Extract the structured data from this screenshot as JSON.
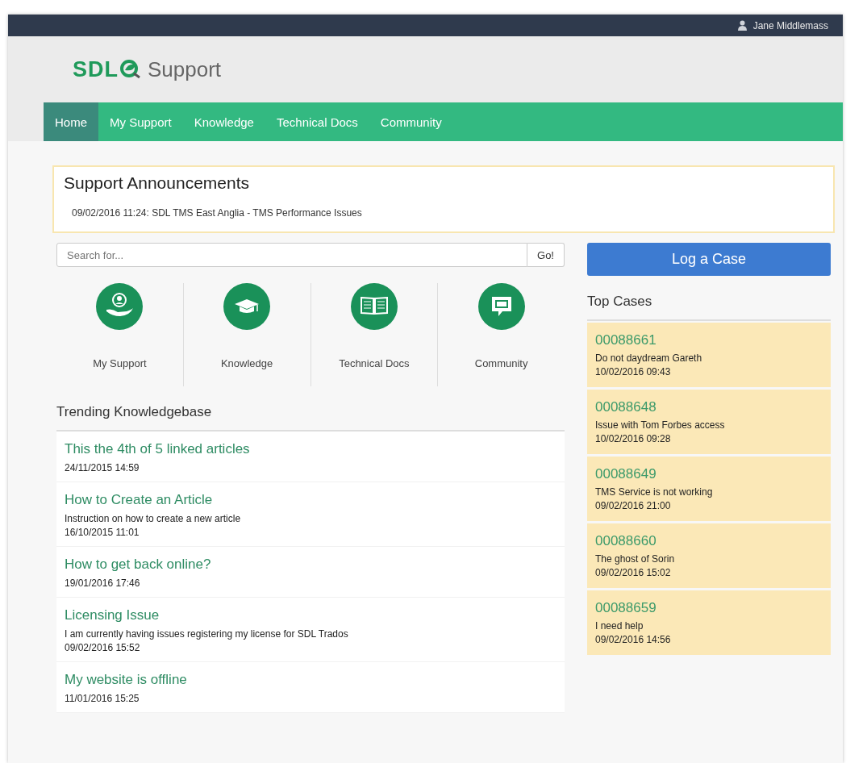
{
  "user": {
    "name": "Jane Middlemass"
  },
  "logo": {
    "brand": "SDL",
    "product": "Support"
  },
  "nav": [
    {
      "label": "Home",
      "selected": true
    },
    {
      "label": "My Support",
      "selected": false
    },
    {
      "label": "Knowledge",
      "selected": false
    },
    {
      "label": "Technical Docs",
      "selected": false
    },
    {
      "label": "Community",
      "selected": false
    }
  ],
  "announcements": {
    "title": "Support Announcements",
    "items": [
      "09/02/2016 11:24: SDL TMS East Anglia - TMS Performance Issues"
    ]
  },
  "search": {
    "placeholder": "Search for...",
    "button": "Go!"
  },
  "tiles": [
    {
      "label": "My Support",
      "kind": "support"
    },
    {
      "label": "Knowledge",
      "kind": "knowledge"
    },
    {
      "label": "Technical Docs",
      "kind": "docs"
    },
    {
      "label": "Community",
      "kind": "community"
    }
  ],
  "trending": {
    "title": "Trending Knowledgebase",
    "articles": [
      {
        "title": "This the 4th of 5 linked articles",
        "date": "24/11/2015 14:59"
      },
      {
        "title": "How to Create an Article",
        "summary": "Instruction on how to create a new article",
        "date": "16/10/2015 11:01"
      },
      {
        "title": "How to get back online?",
        "date": "19/01/2016 17:46"
      },
      {
        "title": "Licensing Issue",
        "summary": "I am currently having issues registering my license for SDL Trados",
        "date": "09/02/2016 15:52"
      },
      {
        "title": "My website is offline",
        "date": "11/01/2016 15:25"
      }
    ]
  },
  "log_case": "Log a Case",
  "top_cases": {
    "title": "Top Cases",
    "cases": [
      {
        "number": "00088661",
        "subject": "Do not daydream Gareth",
        "date": "10/02/2016 09:43"
      },
      {
        "number": "00088648",
        "subject": "Issue with Tom Forbes access",
        "date": "10/02/2016 09:28"
      },
      {
        "number": "00088649",
        "subject": "TMS Service is not working",
        "date": "09/02/2016 21:00"
      },
      {
        "number": "00088660",
        "subject": "The ghost of Sorin",
        "date": "09/02/2016 15:02"
      },
      {
        "number": "00088659",
        "subject": "I need help",
        "date": "09/02/2016 14:56"
      }
    ]
  }
}
